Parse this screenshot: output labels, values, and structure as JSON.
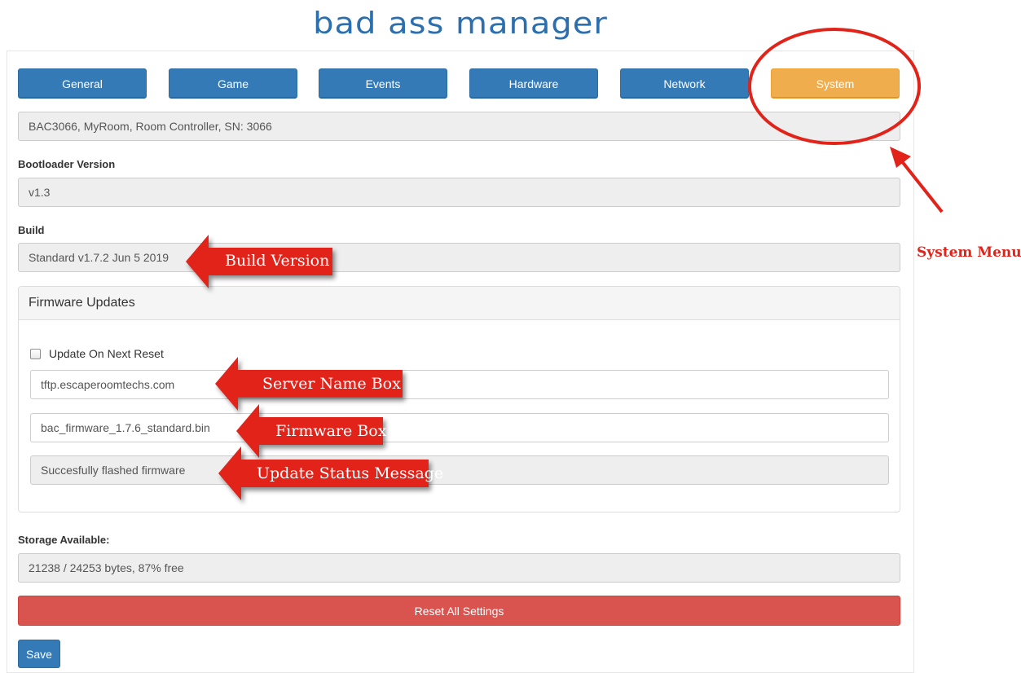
{
  "app": {
    "title": "bad ass manager"
  },
  "tabs": [
    {
      "label": "General",
      "active": false
    },
    {
      "label": "Game",
      "active": false
    },
    {
      "label": "Events",
      "active": false
    },
    {
      "label": "Hardware",
      "active": false
    },
    {
      "label": "Network",
      "active": false
    },
    {
      "label": "System",
      "active": true
    }
  ],
  "device_info": "BAC3066, MyRoom, Room Controller, SN: 3066",
  "bootloader": {
    "label": "Bootloader Version",
    "value": "v1.3"
  },
  "build": {
    "label": "Build",
    "value": "Standard v1.7.2 Jun  5 2019"
  },
  "firmware": {
    "heading": "Firmware Updates",
    "update_on_reset_label": "Update On Next Reset",
    "update_on_reset_checked": false,
    "server_name": "tftp.escaperoomtechs.com",
    "firmware_file": "bac_firmware_1.7.6_standard.bin",
    "status_message": "Succesfully flashed firmware"
  },
  "storage": {
    "label": "Storage Available:",
    "value": "21238 / 24253 bytes, 87% free"
  },
  "actions": {
    "reset_label": "Reset All Settings",
    "save_label": "Save"
  },
  "annotations": {
    "build_version": "Build Version",
    "server_name_box": "Server Name Box",
    "firmware_box": "Firmware Box",
    "update_status": "Update Status Message",
    "system_menu": "System Menu"
  },
  "colors": {
    "primary": "#337ab7",
    "active_tab": "#f0ad4e",
    "danger": "#d9534f",
    "annotation_red": "#e2231a"
  }
}
